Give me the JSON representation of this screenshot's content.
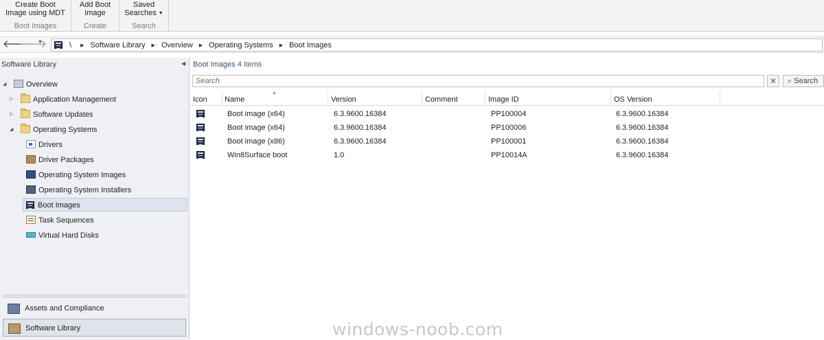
{
  "ribbon": {
    "groups": [
      {
        "label": "Boot Images",
        "buttons": [
          {
            "label_line1": "Create Boot",
            "label_line2": "Image using MDT"
          }
        ]
      },
      {
        "label": "Create",
        "buttons": [
          {
            "label_line1": "Add Boot",
            "label_line2": "Image"
          }
        ]
      },
      {
        "label": "Search",
        "buttons": [
          {
            "label_line1": "Saved",
            "label_line2": "Searches"
          }
        ]
      }
    ]
  },
  "address": {
    "root": "\\",
    "crumbs": [
      "Software Library",
      "Overview",
      "Operating Systems",
      "Boot Images"
    ]
  },
  "nav": {
    "title": "Software Library",
    "tree": {
      "overview": "Overview",
      "app_mgmt": "Application Management",
      "sw_updates": "Software Updates",
      "os": "Operating Systems",
      "drivers": "Drivers",
      "driver_packages": "Driver Packages",
      "os_images": "Operating System Images",
      "os_installers": "Operating System Installers",
      "boot_images": "Boot Images",
      "task_sequences": "Task Sequences",
      "vhd": "Virtual Hard Disks"
    },
    "workspaces": {
      "assets": "Assets and Compliance",
      "library": "Software Library"
    }
  },
  "list": {
    "title": "Boot Images",
    "count": "4 items",
    "search_placeholder": "Search",
    "search_button": "Search",
    "columns": [
      "Icon",
      "Name",
      "Version",
      "Comment",
      "Image ID",
      "OS Version"
    ],
    "rows": [
      {
        "name": "Boot image (x64)",
        "version": "6.3.9600.16384",
        "comment": "",
        "image_id": "PP100004",
        "os_version": "6.3.9600.16384"
      },
      {
        "name": "Boot image (x64)",
        "version": "6.3.9600.16384",
        "comment": "",
        "image_id": "PP100006",
        "os_version": "6.3.9600.16384"
      },
      {
        "name": "Boot image (x86)",
        "version": "6.3.9600.16384",
        "comment": "",
        "image_id": "PP100001",
        "os_version": "6.3.9600.16384"
      },
      {
        "name": "Win8Surface boot",
        "version": "1.0",
        "comment": "",
        "image_id": "PP10014A",
        "os_version": "6.3.9600.16384"
      }
    ]
  },
  "watermark": "windows-noob.com"
}
